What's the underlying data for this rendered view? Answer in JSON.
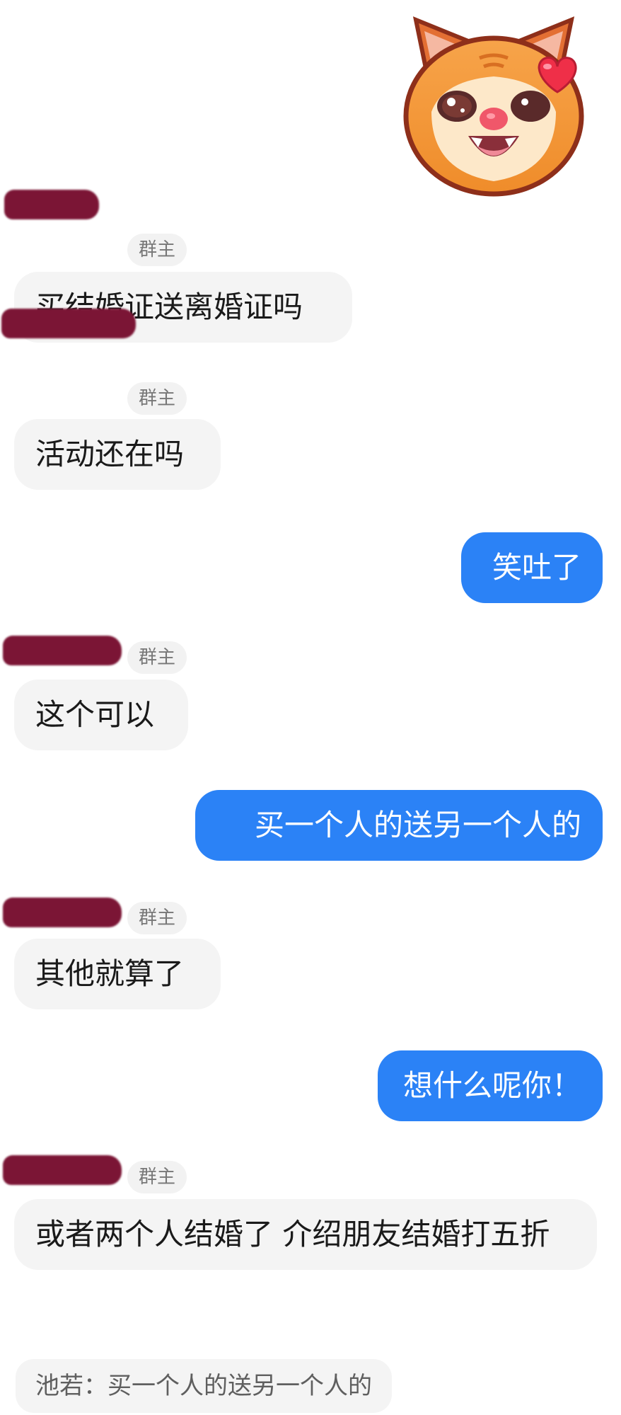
{
  "sticker": {
    "icon": "cat-heart-eyes-sticker"
  },
  "messages": [
    {
      "side": "left",
      "badge": "群主",
      "text": "买结婚证送离婚证吗"
    },
    {
      "side": "left",
      "badge": "群主",
      "text": "活动还在吗"
    },
    {
      "side": "right",
      "text": "笑吐了"
    },
    {
      "side": "left",
      "badge": "群主",
      "text": "这个可以"
    },
    {
      "side": "right",
      "text": "买一个人的送另一个人的"
    },
    {
      "side": "left",
      "badge": "群主",
      "text": "其他就算了"
    },
    {
      "side": "right",
      "text": "想什么呢你！"
    },
    {
      "side": "left",
      "badge": "群主",
      "text": "或者两个人结婚了 介绍朋友结婚打五折"
    }
  ],
  "quote": {
    "text": "池若：买一个人的送另一个人的"
  },
  "colors": {
    "bubble_left": "#f4f4f4",
    "bubble_right": "#2b82f6",
    "redaction": "#7b1535",
    "badge_bg": "#f2f2f2"
  }
}
